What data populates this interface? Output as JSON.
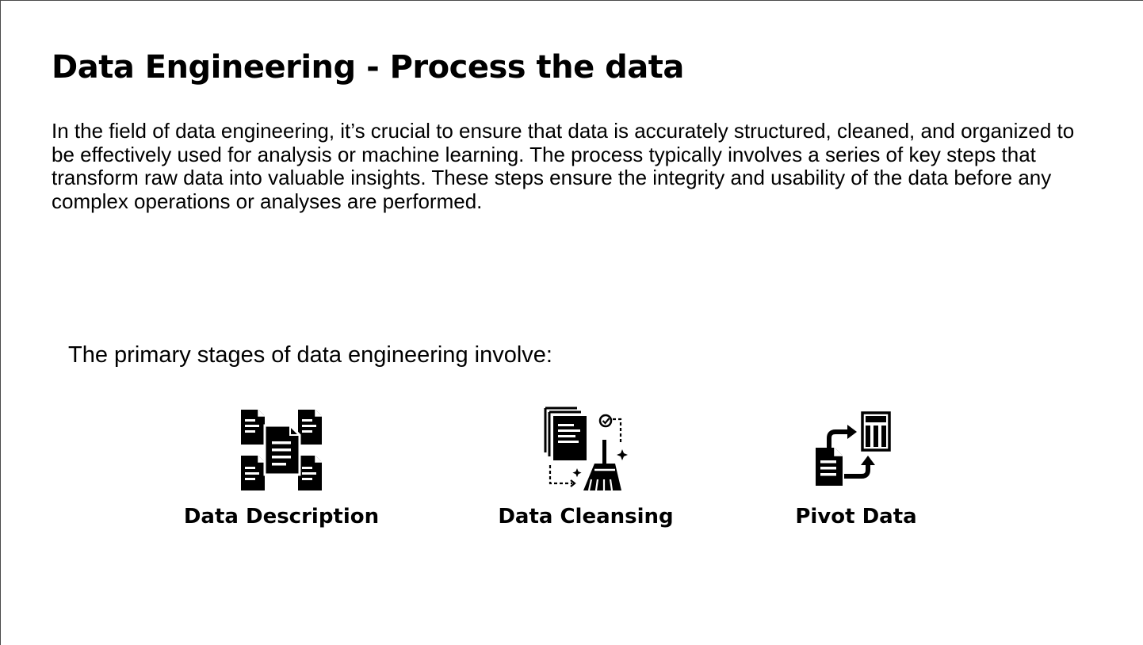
{
  "slide": {
    "title": "Data Engineering - Process the data",
    "intro": "In the field of data engineering, it’s crucial to ensure that data is accurately structured, cleaned, and organized to be effectively used for analysis or machine learning. The process typically involves a series of key steps that transform raw data into valuable insights. These steps ensure the integrity and usability of the data before any complex operations or analyses are performed.",
    "stages_intro": "The primary stages of data engineering involve:",
    "stages": [
      {
        "label": "Data Description",
        "icon": "documents-network-icon"
      },
      {
        "label": "Data Cleansing",
        "icon": "broom-cleansing-icon"
      },
      {
        "label": "Pivot Data",
        "icon": "pivot-transfer-icon"
      }
    ],
    "colors": {
      "text": "#000000",
      "background": "#ffffff",
      "border": "#4a4a4a"
    }
  }
}
